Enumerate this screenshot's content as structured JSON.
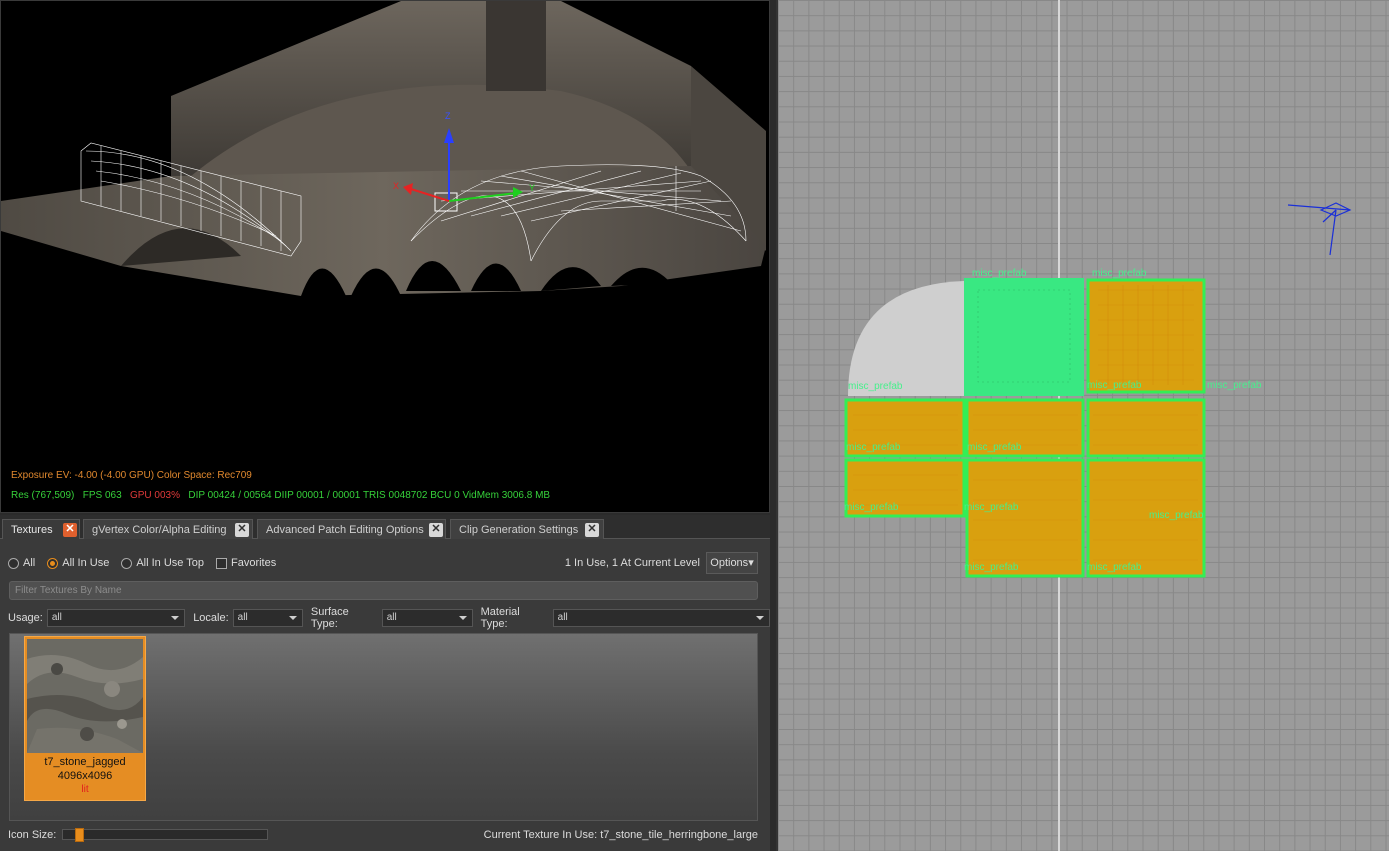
{
  "viewport3d": {
    "hud_line1": "Exposure EV: -4.00 (-4.00 GPU)  Color Space: Rec709",
    "hud_res": "Res (767,509)",
    "hud_fps": "FPS 063",
    "hud_gpu": "GPU 003%",
    "hud_rest": "DIP 00424 / 00564  DIIP 00001 / 00001  TRIS 0048702  BCU 0  VidMem 3006.8 MB",
    "axis_x": "X",
    "axis_y": "Y",
    "axis_z": "Z"
  },
  "tabs": [
    {
      "label": "Textures",
      "active": true
    },
    {
      "label": "gVertex Color/Alpha Editing",
      "active": false
    },
    {
      "label": "Advanced Patch Editing Options",
      "active": false
    },
    {
      "label": "Clip Generation Settings",
      "active": false
    }
  ],
  "close_glyph": "✕",
  "filter_options": {
    "all": "All",
    "all_in_use": "All In Use",
    "all_in_use_top": "All In Use Top",
    "favorites": "Favorites",
    "selected": "All In Use"
  },
  "in_use_summary": "1 In Use, 1 At Current Level",
  "options_label": "Options",
  "filter_placeholder": "Filter Textures By Name",
  "dropdowns": {
    "usage": {
      "label": "Usage:",
      "value": "all"
    },
    "locale": {
      "label": "Locale:",
      "value": "all"
    },
    "surface": {
      "label": "Surface Type:",
      "value": "all"
    },
    "material": {
      "label": "Material Type:",
      "value": "all"
    }
  },
  "texture": {
    "name": "t7_stone_jagged",
    "size": "4096x4096",
    "tag": "lit"
  },
  "icon_size_label": "Icon Size:",
  "icon_size_value": 0.06,
  "current_texture": "Current Texture In Use: t7_stone_tile_herringbone_large",
  "prefab_label": "misc_prefab",
  "colors": {
    "accent": "#e88d1c",
    "hud_orange": "#e0882e",
    "hud_green": "#36d13a",
    "prefab_green": "#47f08c",
    "patch_orange": "#d9a00f"
  }
}
